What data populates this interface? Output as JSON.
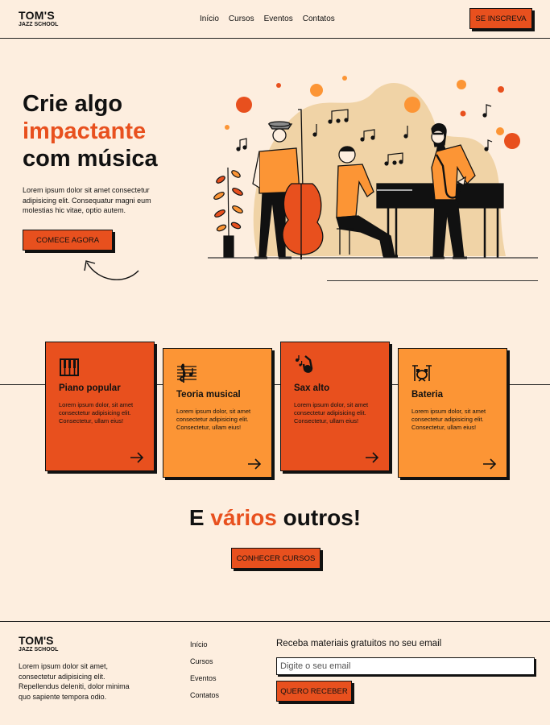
{
  "brand": {
    "name": "TOM'S",
    "sub": "JAZZ SCHOOL"
  },
  "nav": {
    "items": [
      "Início",
      "Cursos",
      "Eventos",
      "Contatos"
    ]
  },
  "header": {
    "signup_label": "SE INSCREVA"
  },
  "hero": {
    "title_line1": "Crie algo",
    "title_accent": "impactante",
    "title_line3": "com música",
    "text": "Lorem ipsum dolor sit amet consectetur adipisicing elit. Consequatur magni eum molestias hic vitae, optio autem.",
    "cta_label": "COMECE AGORA"
  },
  "courses": [
    {
      "title": "Piano popular",
      "text": "Lorem ipsum dolor, sit amet consectetur adipisicing elit. Consectetur, ullam eius!",
      "icon": "piano-icon",
      "color": "#e8501e"
    },
    {
      "title": "Teoria musical",
      "text": "Lorem ipsum dolor, sit amet consectetur adipisicing elit. Consectetur, ullam eius!",
      "icon": "sheet-music-icon",
      "color": "#fc9535"
    },
    {
      "title": "Sax alto",
      "text": "Lorem ipsum dolor, sit amet consectetur adipisicing elit. Consectetur, ullam eius!",
      "icon": "saxophone-icon",
      "color": "#e8501e"
    },
    {
      "title": "Bateria",
      "text": "Lorem ipsum dolor, sit amet consectetur adipisicing elit. Consectetur, ullam eius!",
      "icon": "drums-icon",
      "color": "#fc9535"
    }
  ],
  "others": {
    "title_pre": "E",
    "title_accent": "vários",
    "title_post": "outros!",
    "cta_label": "CONHECER CURSOS"
  },
  "footer": {
    "text": "Lorem ipsum dolor sit amet, consectetur adipisicing elit. Repellendus deleniti, dolor minima quo sapiente tempora odio.",
    "links": [
      "Início",
      "Cursos",
      "Eventos",
      "Contatos"
    ],
    "newsletter_title": "Receba materiais gratuitos no seu email",
    "email_placeholder": "Digite o seu email",
    "submit_label": "QUERO RECEBER"
  },
  "colors": {
    "background": "#fdeedf",
    "accent": "#e8501e",
    "orange": "#fc9535",
    "beige": "#f0d3a6"
  }
}
